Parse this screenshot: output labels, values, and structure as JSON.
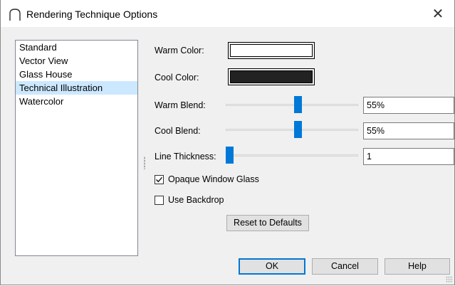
{
  "window": {
    "title": "Rendering Technique Options",
    "close_glyph": "✕"
  },
  "techniques": [
    {
      "label": "Standard",
      "selected": false
    },
    {
      "label": "Vector View",
      "selected": false
    },
    {
      "label": "Glass House",
      "selected": false
    },
    {
      "label": "Technical Illustration",
      "selected": true
    },
    {
      "label": "Watercolor",
      "selected": false
    }
  ],
  "options": {
    "warm_color": {
      "label": "Warm Color:",
      "value": "#ffffff"
    },
    "cool_color": {
      "label": "Cool Color:",
      "value": "#222222"
    },
    "warm_blend": {
      "label": "Warm Blend:",
      "value": "55%",
      "fraction": 0.55
    },
    "cool_blend": {
      "label": "Cool Blend:",
      "value": "55%",
      "fraction": 0.55
    },
    "line_thickness": {
      "label": "Line Thickness:",
      "value": "1",
      "fraction": 0.0
    },
    "opaque_window_glass": {
      "label": "Opaque Window Glass",
      "checked": true
    },
    "use_backdrop": {
      "label": "Use Backdrop",
      "checked": false
    }
  },
  "buttons": {
    "reset": "Reset to Defaults",
    "ok": "OK",
    "cancel": "Cancel",
    "help": "Help"
  },
  "colors": {
    "accent": "#0078d7",
    "selection": "#cce8ff"
  }
}
